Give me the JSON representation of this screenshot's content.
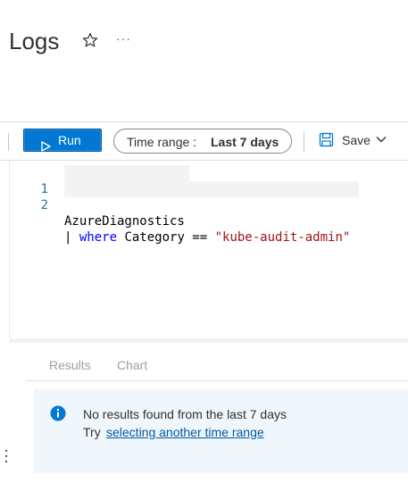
{
  "header": {
    "title": "Logs",
    "favorite_icon": "star-icon",
    "more_icon": "more-icon",
    "more_glyph": "···"
  },
  "toolbar": {
    "run_label": "Run",
    "time_range_label": "Time range :",
    "time_range_value": "Last 7 days",
    "save_label": "Save"
  },
  "editor": {
    "lines": [
      {
        "number": "1",
        "text": "AzureDiagnostics"
      },
      {
        "number": "2",
        "pipe": "| ",
        "keyword": "where",
        "rest": " Category == ",
        "string": "\"kube-audit-admin\""
      }
    ]
  },
  "results": {
    "tabs": [
      {
        "label": "Results"
      },
      {
        "label": "Chart"
      }
    ],
    "message": "No results found from the last 7 days",
    "try_text": "Try",
    "link_text": "selecting another time range"
  },
  "colors": {
    "accent": "#0078d4",
    "info_bg": "#eff6fc",
    "link": "#005a9e",
    "keyword": "#0000ff",
    "string": "#a31515"
  }
}
